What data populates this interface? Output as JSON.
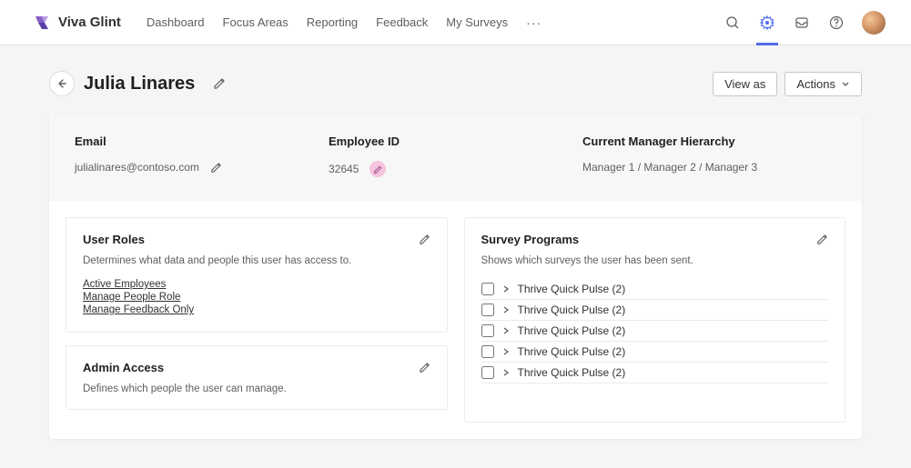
{
  "brand": "Viva Glint",
  "nav": {
    "items": [
      "Dashboard",
      "Focus Areas",
      "Reporting",
      "Feedback",
      "My Surveys"
    ]
  },
  "page": {
    "title": "Julia Linares",
    "view_as": "View as",
    "actions": "Actions"
  },
  "info": {
    "email_label": "Email",
    "email_value": "julialinares@contoso.com",
    "empid_label": "Employee ID",
    "empid_value": "32645",
    "hierarchy_label": "Current Manager Hierarchy",
    "hierarchy_value": "Manager 1 / Manager 2 / Manager 3"
  },
  "user_roles": {
    "title": "User Roles",
    "desc": "Determines what data and people this user has access to.",
    "links": [
      "Active Employees",
      "Manage People Role",
      "Manage Feedback Only"
    ]
  },
  "admin_access": {
    "title": "Admin Access",
    "desc": "Defines which people the user can manage."
  },
  "survey_programs": {
    "title": "Survey Programs",
    "desc": "Shows which surveys the user has been sent.",
    "items": [
      "Thrive Quick Pulse (2)",
      "Thrive Quick Pulse (2)",
      "Thrive Quick Pulse (2)",
      "Thrive Quick Pulse (2)",
      "Thrive Quick Pulse (2)"
    ]
  }
}
